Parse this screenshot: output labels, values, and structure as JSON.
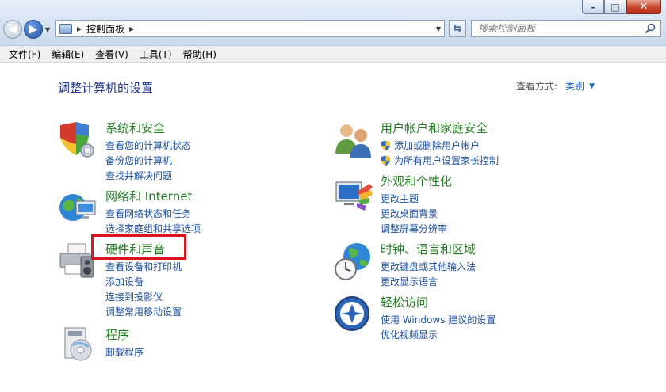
{
  "window": {
    "minimize_icon": "minimize-icon",
    "maximize_icon": "maximize-icon",
    "close_icon": "close-icon"
  },
  "address": {
    "path": "控制面板",
    "search_placeholder": "搜索控制面板"
  },
  "menubar": {
    "items": [
      "文件(F)",
      "编辑(E)",
      "查看(V)",
      "工具(T)",
      "帮助(H)"
    ]
  },
  "main": {
    "heading": "调整计算机的设置",
    "view_by_label": "查看方式:",
    "view_by_value": "类别"
  },
  "categories": {
    "system": {
      "title": "系统和安全",
      "links": [
        "查看您的计算机状态",
        "备份您的计算机",
        "查找并解决问题"
      ]
    },
    "network": {
      "title": "网络和 Internet",
      "links": [
        "查看网络状态和任务",
        "选择家庭组和共享选项"
      ]
    },
    "hardware": {
      "title": "硬件和声音",
      "links": [
        "查看设备和打印机",
        "添加设备",
        "连接到投影仪",
        "调整常用移动设置"
      ]
    },
    "programs": {
      "title": "程序",
      "links": [
        "卸载程序"
      ]
    },
    "users": {
      "title": "用户帐户和家庭安全",
      "links": [
        "添加或删除用户帐户",
        "为所有用户设置家长控制"
      ]
    },
    "appearance": {
      "title": "外观和个性化",
      "links": [
        "更改主题",
        "更改桌面背景",
        "调整屏幕分辨率"
      ]
    },
    "clock": {
      "title": "时钟、语言和区域",
      "links": [
        "更改键盘或其他输入法",
        "更改显示语言"
      ]
    },
    "ease": {
      "title": "轻松访问",
      "links": [
        "使用 Windows 建议的设置",
        "优化视频显示"
      ]
    }
  },
  "colors": {
    "category_title": "#1f7d1f",
    "link": "#1b4fa0",
    "heading": "#1e3287",
    "highlight_box": "#e0141c"
  }
}
